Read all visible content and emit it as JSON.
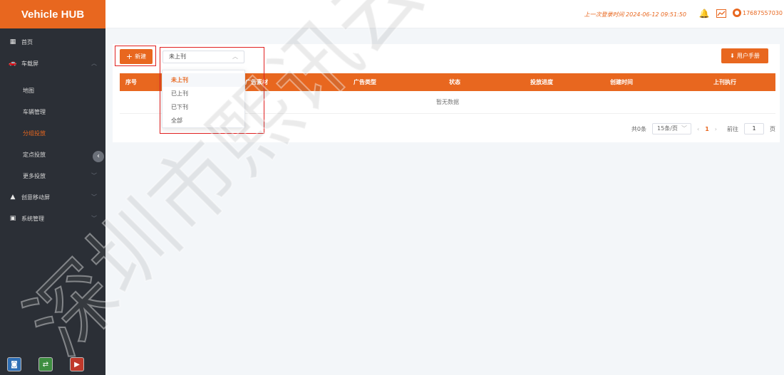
{
  "app": {
    "title": "Vehicle HUB"
  },
  "header": {
    "last_login": "上一次登录时间 2024-06-12 09:51:50",
    "username": "17687557030"
  },
  "sidebar": {
    "items": [
      {
        "label": "首页",
        "icon": "grid-icon"
      },
      {
        "label": "车载屏",
        "icon": "car-icon"
      },
      {
        "label": "地图"
      },
      {
        "label": "车辆管理"
      },
      {
        "label": "分组投放"
      },
      {
        "label": "定点投放"
      },
      {
        "label": "更多投放"
      },
      {
        "label": "创意移动屏",
        "icon": "home-icon"
      },
      {
        "label": "系统管理",
        "icon": "system-icon"
      }
    ]
  },
  "toolbar": {
    "new_label": "新建",
    "status_select": "未上刊",
    "manual_label": "用户手册"
  },
  "table": {
    "columns": [
      "序号",
      "广告素材",
      "广告类型",
      "状态",
      "投放进度",
      "创建时间",
      "上刊执行"
    ],
    "empty_text": "暂无数据"
  },
  "pagination": {
    "total": "共0条",
    "page_size": "15条/页",
    "current_page": "1",
    "goto_label": "前往",
    "goto_value": "1",
    "page_suffix": "页"
  },
  "dropdown": {
    "options": [
      "未上刊",
      "已上刊",
      "已下刊",
      "全部"
    ]
  },
  "watermark": {
    "text": "深圳市熙讯云"
  },
  "colors": {
    "accent": "#e8671f",
    "sidebar": "#2b2f36",
    "highlight": "#e02020"
  }
}
